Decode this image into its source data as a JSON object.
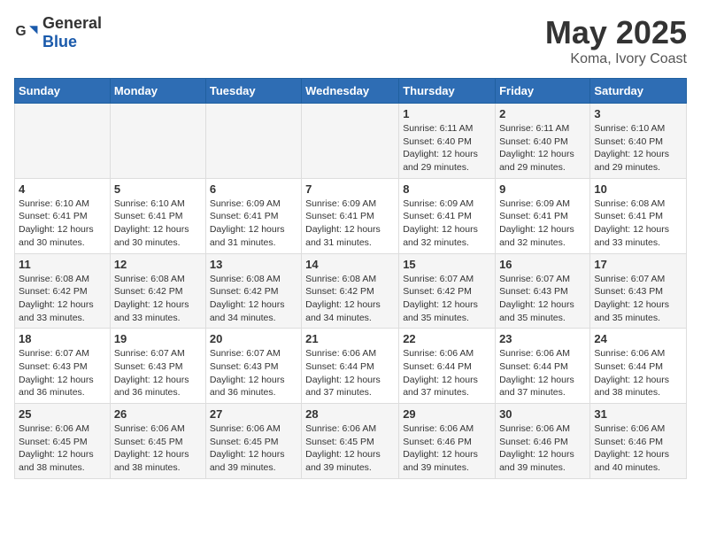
{
  "header": {
    "logo_general": "General",
    "logo_blue": "Blue",
    "title": "May 2025",
    "subtitle": "Koma, Ivory Coast"
  },
  "calendar": {
    "days_of_week": [
      "Sunday",
      "Monday",
      "Tuesday",
      "Wednesday",
      "Thursday",
      "Friday",
      "Saturday"
    ],
    "weeks": [
      [
        {
          "day": "",
          "info": ""
        },
        {
          "day": "",
          "info": ""
        },
        {
          "day": "",
          "info": ""
        },
        {
          "day": "",
          "info": ""
        },
        {
          "day": "1",
          "info": "Sunrise: 6:11 AM\nSunset: 6:40 PM\nDaylight: 12 hours and 29 minutes."
        },
        {
          "day": "2",
          "info": "Sunrise: 6:11 AM\nSunset: 6:40 PM\nDaylight: 12 hours and 29 minutes."
        },
        {
          "day": "3",
          "info": "Sunrise: 6:10 AM\nSunset: 6:40 PM\nDaylight: 12 hours and 29 minutes."
        }
      ],
      [
        {
          "day": "4",
          "info": "Sunrise: 6:10 AM\nSunset: 6:41 PM\nDaylight: 12 hours and 30 minutes."
        },
        {
          "day": "5",
          "info": "Sunrise: 6:10 AM\nSunset: 6:41 PM\nDaylight: 12 hours and 30 minutes."
        },
        {
          "day": "6",
          "info": "Sunrise: 6:09 AM\nSunset: 6:41 PM\nDaylight: 12 hours and 31 minutes."
        },
        {
          "day": "7",
          "info": "Sunrise: 6:09 AM\nSunset: 6:41 PM\nDaylight: 12 hours and 31 minutes."
        },
        {
          "day": "8",
          "info": "Sunrise: 6:09 AM\nSunset: 6:41 PM\nDaylight: 12 hours and 32 minutes."
        },
        {
          "day": "9",
          "info": "Sunrise: 6:09 AM\nSunset: 6:41 PM\nDaylight: 12 hours and 32 minutes."
        },
        {
          "day": "10",
          "info": "Sunrise: 6:08 AM\nSunset: 6:41 PM\nDaylight: 12 hours and 33 minutes."
        }
      ],
      [
        {
          "day": "11",
          "info": "Sunrise: 6:08 AM\nSunset: 6:42 PM\nDaylight: 12 hours and 33 minutes."
        },
        {
          "day": "12",
          "info": "Sunrise: 6:08 AM\nSunset: 6:42 PM\nDaylight: 12 hours and 33 minutes."
        },
        {
          "day": "13",
          "info": "Sunrise: 6:08 AM\nSunset: 6:42 PM\nDaylight: 12 hours and 34 minutes."
        },
        {
          "day": "14",
          "info": "Sunrise: 6:08 AM\nSunset: 6:42 PM\nDaylight: 12 hours and 34 minutes."
        },
        {
          "day": "15",
          "info": "Sunrise: 6:07 AM\nSunset: 6:42 PM\nDaylight: 12 hours and 35 minutes."
        },
        {
          "day": "16",
          "info": "Sunrise: 6:07 AM\nSunset: 6:43 PM\nDaylight: 12 hours and 35 minutes."
        },
        {
          "day": "17",
          "info": "Sunrise: 6:07 AM\nSunset: 6:43 PM\nDaylight: 12 hours and 35 minutes."
        }
      ],
      [
        {
          "day": "18",
          "info": "Sunrise: 6:07 AM\nSunset: 6:43 PM\nDaylight: 12 hours and 36 minutes."
        },
        {
          "day": "19",
          "info": "Sunrise: 6:07 AM\nSunset: 6:43 PM\nDaylight: 12 hours and 36 minutes."
        },
        {
          "day": "20",
          "info": "Sunrise: 6:07 AM\nSunset: 6:43 PM\nDaylight: 12 hours and 36 minutes."
        },
        {
          "day": "21",
          "info": "Sunrise: 6:06 AM\nSunset: 6:44 PM\nDaylight: 12 hours and 37 minutes."
        },
        {
          "day": "22",
          "info": "Sunrise: 6:06 AM\nSunset: 6:44 PM\nDaylight: 12 hours and 37 minutes."
        },
        {
          "day": "23",
          "info": "Sunrise: 6:06 AM\nSunset: 6:44 PM\nDaylight: 12 hours and 37 minutes."
        },
        {
          "day": "24",
          "info": "Sunrise: 6:06 AM\nSunset: 6:44 PM\nDaylight: 12 hours and 38 minutes."
        }
      ],
      [
        {
          "day": "25",
          "info": "Sunrise: 6:06 AM\nSunset: 6:45 PM\nDaylight: 12 hours and 38 minutes."
        },
        {
          "day": "26",
          "info": "Sunrise: 6:06 AM\nSunset: 6:45 PM\nDaylight: 12 hours and 38 minutes."
        },
        {
          "day": "27",
          "info": "Sunrise: 6:06 AM\nSunset: 6:45 PM\nDaylight: 12 hours and 39 minutes."
        },
        {
          "day": "28",
          "info": "Sunrise: 6:06 AM\nSunset: 6:45 PM\nDaylight: 12 hours and 39 minutes."
        },
        {
          "day": "29",
          "info": "Sunrise: 6:06 AM\nSunset: 6:46 PM\nDaylight: 12 hours and 39 minutes."
        },
        {
          "day": "30",
          "info": "Sunrise: 6:06 AM\nSunset: 6:46 PM\nDaylight: 12 hours and 39 minutes."
        },
        {
          "day": "31",
          "info": "Sunrise: 6:06 AM\nSunset: 6:46 PM\nDaylight: 12 hours and 40 minutes."
        }
      ]
    ]
  }
}
